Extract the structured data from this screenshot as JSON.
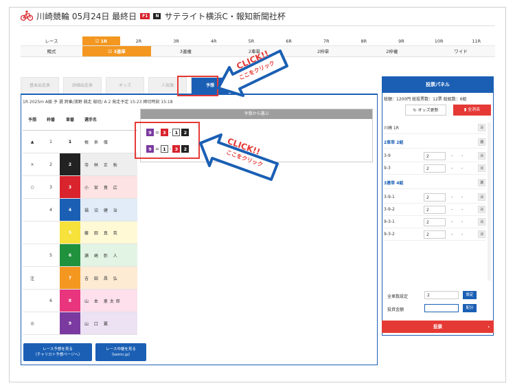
{
  "header": {
    "title": "川崎競輪 05月24日 最終日",
    "badge_f1": "F1",
    "badge_n": "N",
    "race_name": "サテライト横浜C・報知新聞社杯"
  },
  "race_row": {
    "label": "レース",
    "races": [
      "1R",
      "2R",
      "3R",
      "4R",
      "5R",
      "6R",
      "7R",
      "8R",
      "9R",
      "10R",
      "11R"
    ],
    "active_index": 0
  },
  "bet_row": {
    "label": "賭式",
    "types": [
      "3連単",
      "3連複",
      "2車単",
      "2枠単",
      "2枠複",
      "ワイド"
    ],
    "active_index": 0
  },
  "tabs": [
    "基本出走表",
    "詳細出走表",
    "オッズ",
    "人気順",
    "予想"
  ],
  "active_tab_index": 4,
  "race_info": "1R 2025m A級 予 選 跨乗/濱野 競走 級班/ A 2 発走予定 15:23 締切時刻 15:18",
  "table": {
    "headers": {
      "yoso": "予想",
      "waku": "枠番",
      "sha": "車番",
      "name": "選手名"
    },
    "rows": [
      {
        "yoso": "▲",
        "waku": "1",
        "sha": "1",
        "name": "根 来 傑",
        "bg": "#ffffff",
        "fg": "#000000"
      },
      {
        "yoso": "×",
        "waku": "2",
        "sha": "2",
        "name": "寺 林 正 秋",
        "bg": "#222222",
        "fg": "#ffffff"
      },
      {
        "yoso": "○",
        "waku": "3",
        "sha": "3",
        "name": "小 宮 貴 広",
        "bg": "#d9232d",
        "fg": "#ffffff"
      },
      {
        "yoso": "",
        "waku": "4",
        "sha": "4",
        "name": "福 沼 健 治",
        "bg": "#1a5fb4",
        "fg": "#ffffff"
      },
      {
        "yoso": "",
        "waku": "",
        "sha": "5",
        "name": "藤 田 真 英",
        "bg": "#f7e13b",
        "fg": "#ffffff"
      },
      {
        "yoso": "",
        "waku": "5",
        "sha": "6",
        "name": "瀬 崎 彰 人",
        "bg": "#20913d",
        "fg": "#ffffff"
      },
      {
        "yoso": "注",
        "waku": "",
        "sha": "7",
        "name": "吉 田 昌 弘",
        "bg": "#f39720",
        "fg": "#ffffff"
      },
      {
        "yoso": "",
        "waku": "6",
        "sha": "8",
        "name": "山 本 恵太郎",
        "bg": "#e8357e",
        "fg": "#ffffff"
      },
      {
        "yoso": "◎",
        "waku": "",
        "sha": "9",
        "name": "山 口 翼",
        "bg": "#7b3aa0",
        "fg": "#ffffff"
      }
    ]
  },
  "pick_panel": {
    "title": "予想から選ぶ",
    "line1": {
      "a": "9",
      "sep1": "=",
      "b": "3",
      "sep2": "-",
      "c": "1",
      "d": "2"
    },
    "line2": {
      "a": "9",
      "sep1": "=",
      "b": "1",
      "sep2": "-",
      "c": "3",
      "d": "2"
    }
  },
  "bottom_buttons": {
    "yoso_line1": "レース予想を見る",
    "yoso_line2": "（チャリロト予想ページへ）",
    "live_line1": "レース中継を見る",
    "live_line2": "（keirin.jp）"
  },
  "vote_panel": {
    "title": "投票パネル",
    "summary": "総額：1200円 総投票数：12票 総組数：6組",
    "odds_update": "オッズ更新",
    "clear_all": "全消去",
    "race": "川崎 1R",
    "section1": "2車単 2組",
    "section2": "3連単 4組",
    "bets": [
      {
        "combo": "3-9",
        "amount": "2"
      },
      {
        "combo": "9-3",
        "amount": "2"
      },
      {
        "combo": "3-9-1",
        "amount": "2"
      },
      {
        "combo": "3-9-2",
        "amount": "2"
      },
      {
        "combo": "9-3-1",
        "amount": "2"
      },
      {
        "combo": "9-3-2",
        "amount": "2"
      }
    ],
    "delete_label": "消",
    "bulk_label": "全車数設定",
    "bulk_value": "2",
    "bulk_set": "設定",
    "amount_label": "投資金額",
    "amount_value": "",
    "distribute": "配分",
    "submit": "投票"
  },
  "callouts": {
    "text_top": "CLICK!!",
    "text_bottom": "ここをクリック"
  }
}
